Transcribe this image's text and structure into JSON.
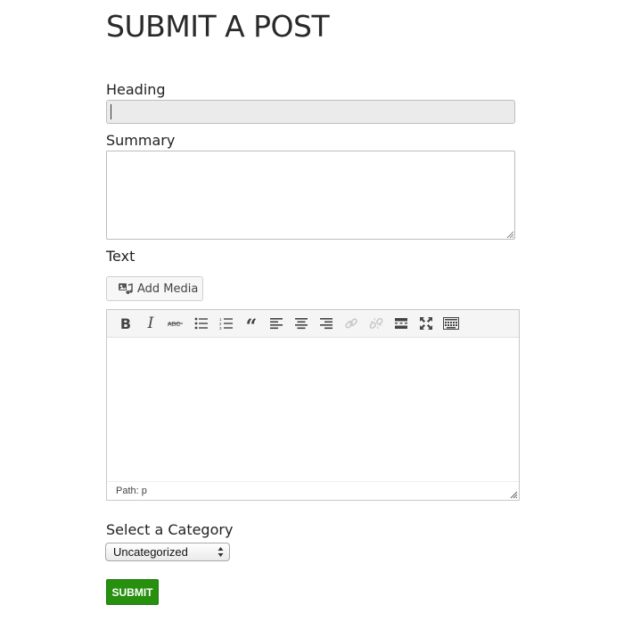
{
  "page": {
    "title": "SUBMIT A POST"
  },
  "form": {
    "heading": {
      "label": "Heading",
      "value": ""
    },
    "summary": {
      "label": "Summary",
      "value": ""
    },
    "text": {
      "label": "Text",
      "add_media_label": "Add Media",
      "toolbar": [
        {
          "name": "bold-icon",
          "title": "Bold"
        },
        {
          "name": "italic-icon",
          "title": "Italic"
        },
        {
          "name": "strikethrough-icon",
          "title": "Strikethrough"
        },
        {
          "name": "bulleted-list-icon",
          "title": "Bulleted list"
        },
        {
          "name": "numbered-list-icon",
          "title": "Numbered list"
        },
        {
          "name": "blockquote-icon",
          "title": "Blockquote"
        },
        {
          "name": "align-left-icon",
          "title": "Align left"
        },
        {
          "name": "align-center-icon",
          "title": "Align center"
        },
        {
          "name": "align-right-icon",
          "title": "Align right"
        },
        {
          "name": "insert-link-icon",
          "title": "Insert link",
          "disabled": true
        },
        {
          "name": "remove-link-icon",
          "title": "Remove link",
          "disabled": true
        },
        {
          "name": "read-more-icon",
          "title": "Insert Read More tag"
        },
        {
          "name": "fullscreen-icon",
          "title": "Fullscreen"
        },
        {
          "name": "toolbar-toggle-icon",
          "title": "Toolbar toggle"
        }
      ],
      "status_path": "Path: p"
    },
    "category": {
      "label": "Select a Category",
      "selected": "Uncategorized"
    },
    "submit_label": "SUBMIT"
  }
}
